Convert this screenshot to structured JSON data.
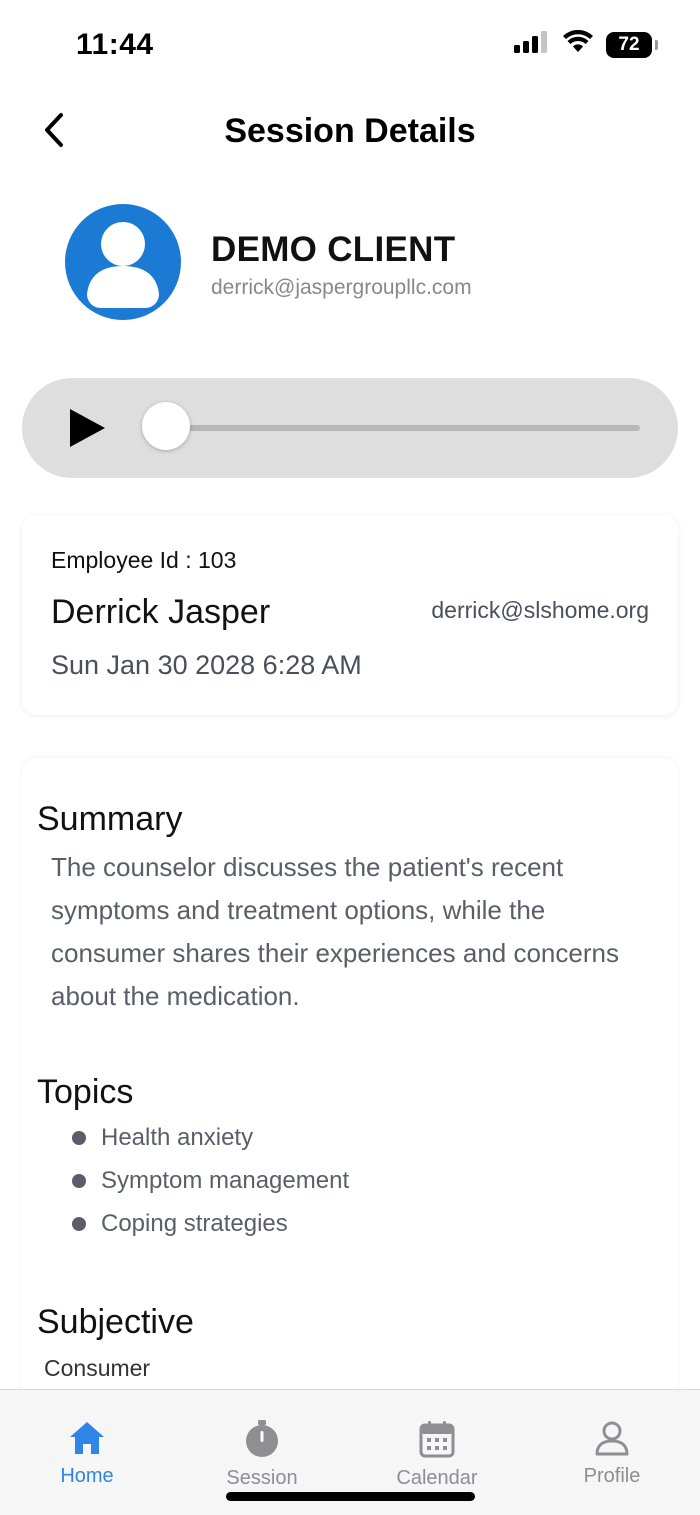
{
  "status_bar": {
    "time": "11:44",
    "battery": "72",
    "icons": [
      "signal-icon",
      "wifi-icon",
      "battery-icon"
    ]
  },
  "header": {
    "title": "Session Details",
    "back_icon": "chevron-left-icon"
  },
  "client": {
    "name": "DEMO CLIENT",
    "email": "derrick@jaspergroupllc.com",
    "avatar_icon": "user-avatar-icon",
    "avatar_color": "#1a7ad4"
  },
  "player": {
    "play_icon": "play-icon",
    "progress": 0
  },
  "session_info": {
    "employee_id": "Employee Id : 103",
    "employee_name": "Derrick Jasper",
    "employee_email": "derrick@slshome.org",
    "date": "Sun Jan 30 2028 6:28 AM"
  },
  "details": {
    "summary_heading": "Summary",
    "summary_text": "The counselor discusses the patient's recent symptoms and treatment options, while the consumer shares their experiences and concerns about the medication.",
    "topics_heading": "Topics",
    "topics": [
      "Health anxiety",
      "Symptom management",
      "Coping strategies"
    ],
    "subjective_heading": "Subjective",
    "subjective_subheading": "Consumer"
  },
  "tab_bar": {
    "active_color": "#2f86e8",
    "inactive_color": "#8e8e93",
    "tabs": [
      {
        "label": "Home",
        "icon": "home-icon",
        "active": true
      },
      {
        "label": "Session",
        "icon": "stopwatch-icon",
        "active": false
      },
      {
        "label": "Calendar",
        "icon": "calendar-icon",
        "active": false
      },
      {
        "label": "Profile",
        "icon": "person-icon",
        "active": false
      }
    ]
  }
}
